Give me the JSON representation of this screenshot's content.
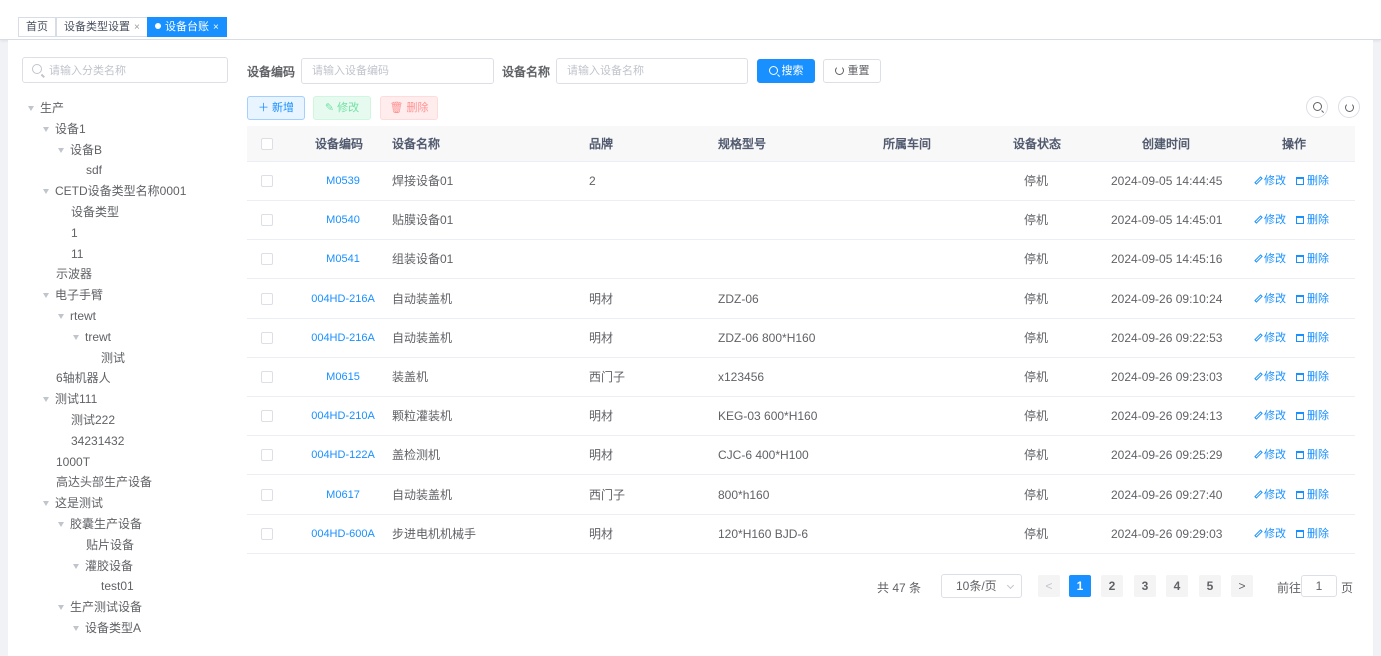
{
  "tabs": [
    {
      "label": "首页",
      "closable": false,
      "active": false
    },
    {
      "label": "设备类型设置",
      "closable": true,
      "active": false
    },
    {
      "label": "设备台账",
      "closable": true,
      "active": true
    }
  ],
  "tree": {
    "search_placeholder": "请输入分类名称",
    "nodes": [
      {
        "label": "生产",
        "expanded": true
      },
      {
        "label": "设备1",
        "expanded": true
      },
      {
        "label": "设备B",
        "expanded": true
      },
      {
        "label": "sdf"
      },
      {
        "label": "CETD设备类型名称0001",
        "expanded": true
      },
      {
        "label": "设备类型"
      },
      {
        "label": "1"
      },
      {
        "label": "11"
      },
      {
        "label": "示波器"
      },
      {
        "label": "电子手臂",
        "expanded": true
      },
      {
        "label": "rtewt",
        "expanded": true
      },
      {
        "label": "trewt",
        "expanded": true
      },
      {
        "label": "测试"
      },
      {
        "label": "6轴机器人"
      },
      {
        "label": "测试111",
        "expanded": true
      },
      {
        "label": "测试222"
      },
      {
        "label": "34231432"
      },
      {
        "label": "1000T"
      },
      {
        "label": "高达头部生产设备"
      },
      {
        "label": "这是测试",
        "expanded": true
      },
      {
        "label": "胶囊生产设备",
        "expanded": true
      },
      {
        "label": "贴片设备"
      },
      {
        "label": "灌胶设备",
        "expanded": true
      },
      {
        "label": "test01"
      },
      {
        "label": "生产测试设备",
        "expanded": true
      },
      {
        "label": "设备类型A",
        "expanded": true
      }
    ]
  },
  "query": {
    "code_label": "设备编码",
    "code_placeholder": "请输入设备编码",
    "name_label": "设备名称",
    "name_placeholder": "请输入设备名称",
    "search_button": "搜索",
    "reset_button": "重置"
  },
  "toolbar": {
    "add_button": "新增",
    "edit_button": "修改",
    "delete_button": "删除"
  },
  "table": {
    "columns": [
      "设备编码",
      "设备名称",
      "品牌",
      "规格型号",
      "所属车间",
      "设备状态",
      "创建时间",
      "操作"
    ],
    "edit_label": "修改",
    "delete_label": "删除",
    "rows": [
      {
        "code": "M0539",
        "name": "焊接设备01",
        "brand": "2",
        "spec": "",
        "workshop": "",
        "status": "停机",
        "created": "2024-09-05 14:44:45"
      },
      {
        "code": "M0540",
        "name": "贴膜设备01",
        "brand": "",
        "spec": "",
        "workshop": "",
        "status": "停机",
        "created": "2024-09-05 14:45:01"
      },
      {
        "code": "M0541",
        "name": "组装设备01",
        "brand": "",
        "spec": "",
        "workshop": "",
        "status": "停机",
        "created": "2024-09-05 14:45:16"
      },
      {
        "code": "004HD-216A",
        "name": "自动装盖机",
        "brand": "明材",
        "spec": "ZDZ-06",
        "workshop": "",
        "status": "停机",
        "created": "2024-09-26 09:10:24"
      },
      {
        "code": "004HD-216A",
        "name": "自动装盖机",
        "brand": "明材",
        "spec": "ZDZ-06 800*H160",
        "workshop": "",
        "status": "停机",
        "created": "2024-09-26 09:22:53"
      },
      {
        "code": "M0615",
        "name": "装盖机",
        "brand": "西门子",
        "spec": "x123456",
        "workshop": "",
        "status": "停机",
        "created": "2024-09-26 09:23:03"
      },
      {
        "code": "004HD-210A",
        "name": "颗粒灌装机",
        "brand": "明材",
        "spec": "KEG-03 600*H160",
        "workshop": "",
        "status": "停机",
        "created": "2024-09-26 09:24:13"
      },
      {
        "code": "004HD-122A",
        "name": "盖检测机",
        "brand": "明材",
        "spec": "CJC-6 400*H100",
        "workshop": "",
        "status": "停机",
        "created": "2024-09-26 09:25:29"
      },
      {
        "code": "M0617",
        "name": "自动装盖机",
        "brand": "西门子",
        "spec": "800*h160",
        "workshop": "",
        "status": "停机",
        "created": "2024-09-26 09:27:40"
      },
      {
        "code": "004HD-600A",
        "name": "步进电机机械手",
        "brand": "明材",
        "spec": "120*H160 BJD-6",
        "workshop": "",
        "status": "停机",
        "created": "2024-09-26 09:29:03"
      }
    ]
  },
  "pagination": {
    "total_text": "共 47 条",
    "page_size": "10条/页",
    "pages": [
      "1",
      "2",
      "3",
      "4",
      "5"
    ],
    "current": "1",
    "goto_prefix": "前往",
    "goto_value": "1",
    "goto_suffix": "页"
  },
  "colors": {
    "primary": "#1890ff",
    "text": "#606266",
    "border": "#dcdfe6"
  }
}
